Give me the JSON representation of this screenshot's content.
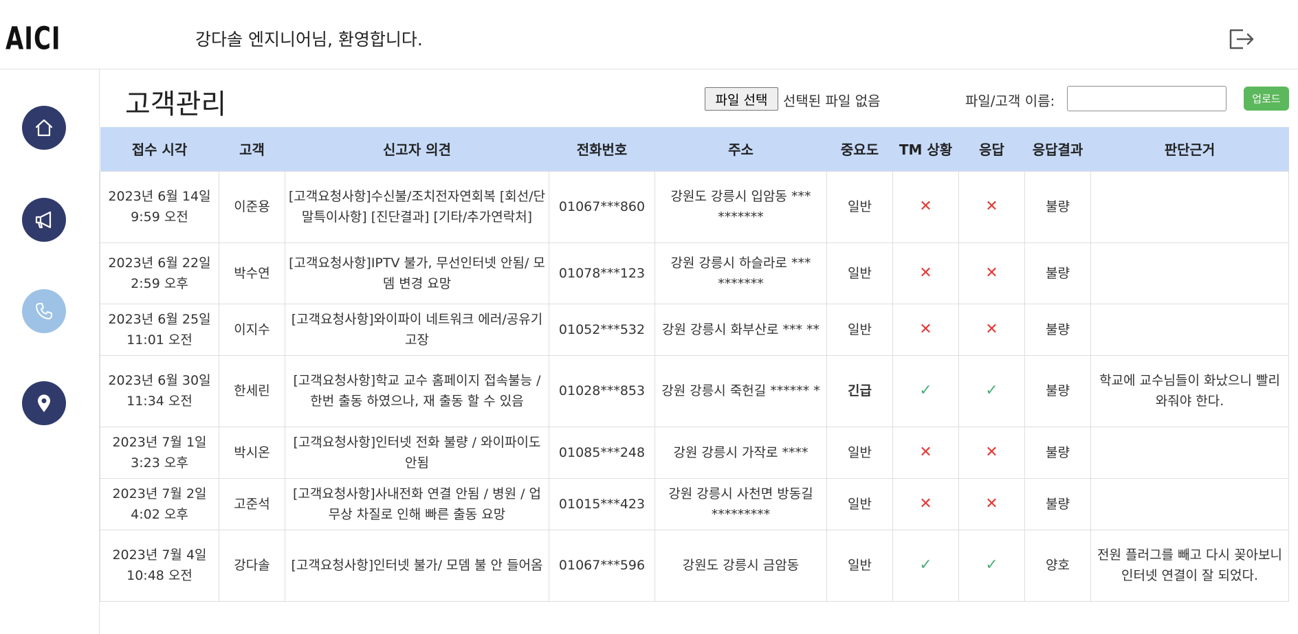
{
  "header": {
    "logo_text": "AICI",
    "welcome": "강다솔 엔지니어님, 환영합니다."
  },
  "sidebar": {
    "items": [
      {
        "name": "home",
        "icon": "home-icon",
        "active": false
      },
      {
        "name": "notice",
        "icon": "megaphone-icon",
        "active": false
      },
      {
        "name": "customer",
        "icon": "phone-icon",
        "active": true
      },
      {
        "name": "location",
        "icon": "map-pin-icon",
        "active": false
      }
    ]
  },
  "main": {
    "title": "고객관리",
    "file_button": "파일 선택",
    "file_status": "선택된 파일 없음",
    "name_label": "파일/고객 이름:",
    "name_value": "",
    "upload_button": "업로드"
  },
  "colors": {
    "nav": "#303b6c",
    "nav_active": "#9dc2e6",
    "table_header": "#c6daf8",
    "upload": "#5cb85c",
    "bad": "#e53935",
    "good": "#4caf79"
  },
  "table": {
    "columns": [
      "접수 시각",
      "고객",
      "신고자 의견",
      "전화번호",
      "주소",
      "중요도",
      "TM 상황",
      "응답",
      "응답결과",
      "판단근거"
    ],
    "rows": [
      {
        "time": "2023년 6월 14일 9:59 오전",
        "customer": "이준용",
        "opinion": "[고객요청사항]수신불/조치전자연회복 [회선/단말특이사항] [진단결과] [기타/추가연락처]",
        "phone": "01067***860",
        "address": "강원도 강릉시 입암동 *** *******",
        "priority": "일반",
        "tm": "x",
        "response": "x",
        "result": "불량",
        "reason": ""
      },
      {
        "time": "2023년 6월 22일 2:59 오후",
        "customer": "박수연",
        "opinion": "[고객요청사항]IPTV 불가, 무선인터넷 안됨/ 모뎀 변경 요망",
        "phone": "01078***123",
        "address": "강원 강릉시 하슬라로 *** *******",
        "priority": "일반",
        "tm": "x",
        "response": "x",
        "result": "불량",
        "reason": ""
      },
      {
        "time": "2023년 6월 25일 11:01 오전",
        "customer": "이지수",
        "opinion": "[고객요청사항]와이파이 네트워크 에러/공유기 고장",
        "phone": "01052***532",
        "address": "강원 강릉시 화부산로 *** **",
        "priority": "일반",
        "tm": "x",
        "response": "x",
        "result": "불량",
        "reason": ""
      },
      {
        "time": "2023년 6월 30일 11:34 오전",
        "customer": "한세린",
        "opinion": "[고객요청사항]학교 교수 홈페이지 접속불능 / 한번 출동 하였으나, 재 출동 할 수 있음",
        "phone": "01028***853",
        "address": "강원 강릉시 죽헌길 ****** *",
        "priority": "긴급",
        "tm": "ok",
        "response": "ok",
        "result": "불량",
        "reason": "학교에 교수님들이 화났으니 빨리 와줘야 한다."
      },
      {
        "time": "2023년 7월 1일 3:23 오후",
        "customer": "박시온",
        "opinion": "[고객요청사항]인터넷 전화 불량 / 와이파이도 안됨",
        "phone": "01085***248",
        "address": "강원 강릉시 가작로 ****",
        "priority": "일반",
        "tm": "x",
        "response": "x",
        "result": "불량",
        "reason": ""
      },
      {
        "time": "2023년 7월 2일 4:02 오후",
        "customer": "고준석",
        "opinion": "[고객요청사항]사내전화 연결 안됨 / 병원 / 업무상 차질로 인해 빠른 출동 요망",
        "phone": "01015***423",
        "address": "강원 강릉시 사천면 방동길 *********",
        "priority": "일반",
        "tm": "x",
        "response": "x",
        "result": "불량",
        "reason": ""
      },
      {
        "time": "2023년 7월 4일 10:48 오전",
        "customer": "강다솔",
        "opinion": "[고객요청사항]인터넷 불가/ 모뎀 불 안 들어옴",
        "phone": "01067***596",
        "address": "강원도 강릉시 금암동",
        "priority": "일반",
        "tm": "ok",
        "response": "ok",
        "result": "양호",
        "reason": "전원 플러그를 빼고 다시 꽂아보니 인터넷 연결이 잘 되었다."
      }
    ]
  }
}
